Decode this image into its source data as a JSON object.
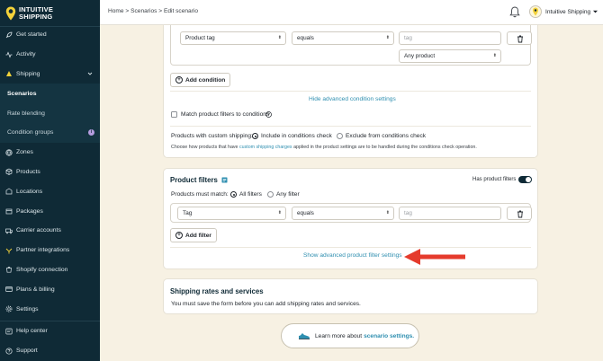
{
  "brand": {
    "line1": "INTUITIVE",
    "line2": "SHIPPING"
  },
  "sidebar": {
    "items": [
      {
        "label": "Get started",
        "icon": "rocket-icon"
      },
      {
        "label": "Activity",
        "icon": "activity-icon"
      },
      {
        "label": "Shipping",
        "icon": "shipping-icon"
      },
      {
        "label": "Scenarios"
      },
      {
        "label": "Rate blending"
      },
      {
        "label": "Condition groups"
      },
      {
        "label": "Zones",
        "icon": "globe-icon"
      },
      {
        "label": "Products",
        "icon": "box-icon"
      },
      {
        "label": "Locations",
        "icon": "location-icon"
      },
      {
        "label": "Packages",
        "icon": "package-icon"
      },
      {
        "label": "Carrier accounts",
        "icon": "carrier-icon"
      },
      {
        "label": "Partner integrations",
        "icon": "integration-icon"
      },
      {
        "label": "Shopify connection",
        "icon": "shopify-icon"
      },
      {
        "label": "Plans & billing",
        "icon": "billing-icon"
      },
      {
        "label": "Settings",
        "icon": "gear-icon"
      },
      {
        "label": "Help center",
        "icon": "help-icon"
      },
      {
        "label": "Support",
        "icon": "support-icon"
      }
    ],
    "condition_groups_badge": "i"
  },
  "topbar": {
    "breadcrumb": "Home > Scenarios > Edit scenario",
    "account_name": "Intuitive Shipping"
  },
  "conditions": {
    "field": "Product tag",
    "operator": "equals",
    "value_placeholder": "tag",
    "match": "Any product",
    "add_label": "Add condition",
    "advanced_link": "Hide advanced condition settings",
    "match_filters_label": "Match product filters to conditions",
    "custom_shipping_label": "Products with custom shipping:",
    "include_label": "Include in conditions check",
    "exclude_label": "Exclude from conditions check",
    "help_before": "Choose how products that have",
    "help_link": "custom shipping charges",
    "help_after": "applied in the product settings are to be handled during the conditions check operation."
  },
  "product_filters": {
    "title": "Product filters",
    "has_label": "Has product filters",
    "must_match_label": "Products must match:",
    "all_label": "All filters",
    "any_label": "Any filter",
    "field": "Tag",
    "operator": "equals",
    "value_placeholder": "tag",
    "add_label": "Add filter",
    "advanced_link": "Show advanced product filter settings"
  },
  "rates": {
    "title": "Shipping rates and services",
    "message": "You must save the form before you can add shipping rates and services."
  },
  "learn": {
    "prefix": "Learn more about",
    "link": "scenario settings."
  },
  "colors": {
    "sidebar": "#0f2a36",
    "background": "#f7f1e3",
    "link": "#2f8fb0",
    "arrow": "#e53b2c"
  }
}
